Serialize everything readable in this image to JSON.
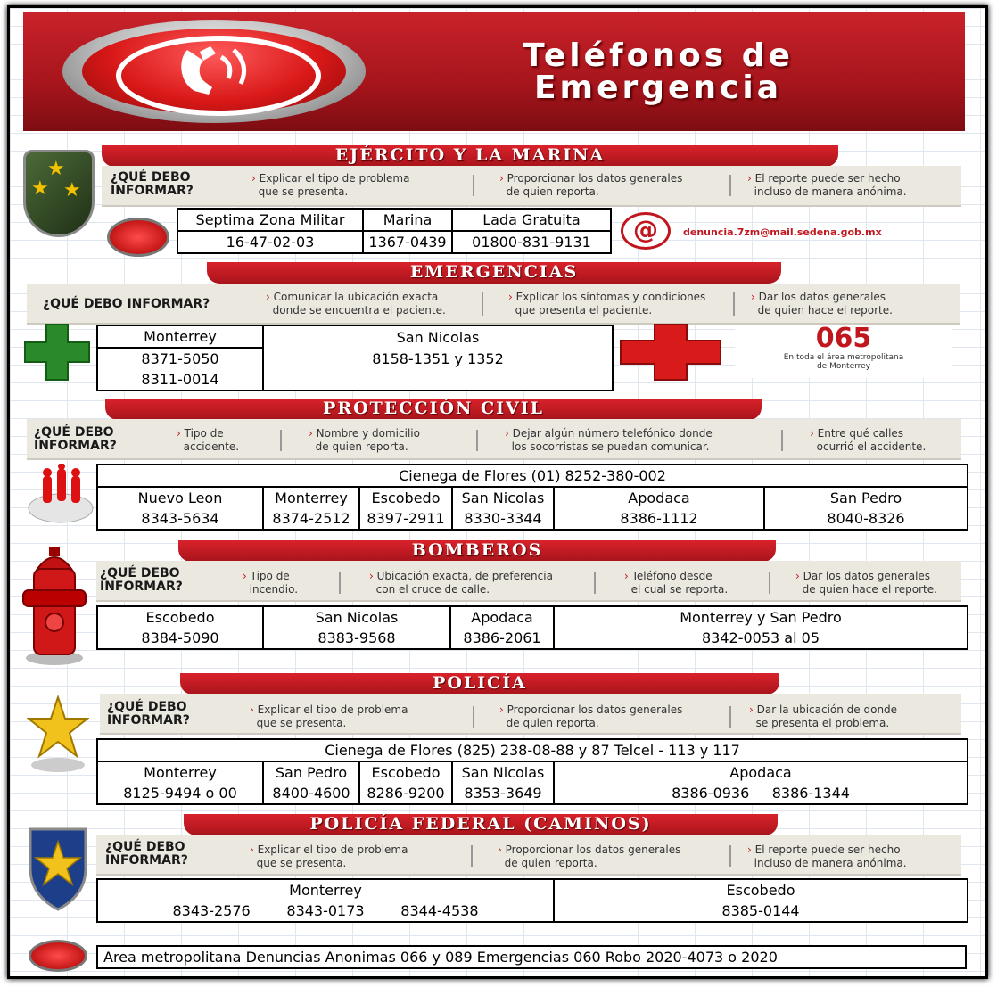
{
  "header": {
    "title_line1": "Teléfonos de",
    "title_line2": "Emergencia"
  },
  "common": {
    "q_two_line_1": "¿QUÉ DEBO",
    "q_two_line_2": "INFORMAR?",
    "q_single": "¿QUÉ DEBO INFORMAR?"
  },
  "ejercito": {
    "ribbon": "EJÉRCITO Y LA MARINA",
    "notes": [
      [
        "Explicar el tipo de problema",
        "que se presenta."
      ],
      [
        "Proporcionar los datos generales",
        "de quien reporta."
      ],
      [
        "El reporte puede ser hecho",
        "incluso de manera anónima."
      ]
    ],
    "cells": [
      [
        "Septima Zona Militar",
        "16-47-02-03"
      ],
      [
        "Marina",
        "1367-0439"
      ],
      [
        "Lada Gratuita",
        "01800-831-9131"
      ]
    ],
    "email": "denuncia.7zm@mail.sedena.gob.mx",
    "at": "@"
  },
  "emergencias": {
    "ribbon": "EMERGENCIAS",
    "notes": [
      [
        "Comunicar la ubicación exacta",
        "donde se encuentra el paciente."
      ],
      [
        "Explicar los síntomas y condiciones",
        "que presenta el paciente."
      ],
      [
        "Dar los datos generales",
        "de quien hace el reporte."
      ]
    ],
    "cells": [
      [
        "Monterrey",
        "8371-5050",
        "8311-0014"
      ],
      [
        "San Nicolas",
        "8158-1351 y 1352"
      ]
    ],
    "badge_number": "065",
    "badge_text_1": "En toda el área metropolitana",
    "badge_text_2": "de Monterrey"
  },
  "proteccion": {
    "ribbon": "PROTECCIÓN CIVIL",
    "notes": [
      [
        "Tipo de",
        "accidente."
      ],
      [
        "Nombre y domicilio",
        "de quien reporta."
      ],
      [
        "Dejar algún número telefónico donde",
        "los socorristas se puedan comunicar."
      ],
      [
        "Entre qué calles",
        "ocurrió el accidente."
      ]
    ],
    "top_row": "Cienega de Flores (01) 8252-380-002",
    "cells": [
      [
        "Nuevo Leon",
        "8343-5634"
      ],
      [
        "Monterrey",
        "8374-2512"
      ],
      [
        "Escobedo",
        "8397-2911"
      ],
      [
        "San Nicolas",
        "8330-3344"
      ],
      [
        "Apodaca",
        "8386-1112"
      ],
      [
        "San Pedro",
        "8040-8326"
      ]
    ]
  },
  "bomberos": {
    "ribbon": "BOMBEROS",
    "notes": [
      [
        "Tipo de",
        "incendio."
      ],
      [
        "Ubicación exacta, de preferencia",
        "con el cruce de calle."
      ],
      [
        "Teléfono desde",
        "el cual se reporta."
      ],
      [
        "Dar los datos generales",
        "de quien hace el reporte."
      ]
    ],
    "cells": [
      [
        "Escobedo",
        "8384-5090"
      ],
      [
        "San Nicolas",
        "8383-9568"
      ],
      [
        "Apodaca",
        "8386-2061"
      ],
      [
        "Monterrey y San Pedro",
        "8342-0053 al 05"
      ]
    ]
  },
  "policia": {
    "ribbon": "POLICÍA",
    "notes": [
      [
        "Explicar el tipo de problema",
        "que se presenta."
      ],
      [
        "Proporcionar los datos generales",
        "de quien reporta."
      ],
      [
        "Dar la ubicación de donde",
        "se presenta el problema."
      ]
    ],
    "top_row": "Cienega de Flores (825) 238-08-88 y 87  Telcel -  113 y 117",
    "cells": [
      [
        "Monterrey",
        "8125-9494 o 00"
      ],
      [
        "San Pedro",
        "8400-4600"
      ],
      [
        "Escobedo",
        "8286-9200"
      ],
      [
        "San Nicolas",
        "8353-3649"
      ],
      [
        "Apodaca",
        "8386-0936     8386-1344"
      ]
    ]
  },
  "federal": {
    "ribbon": "POLICÍA FEDERAL (CAMINOS)",
    "notes": [
      [
        "Explicar el tipo de problema",
        "que se presenta."
      ],
      [
        "Proporcionar los datos generales",
        "de quien reporta."
      ],
      [
        "El reporte puede ser hecho",
        "incluso de manera anónima."
      ]
    ],
    "cells": [
      [
        "Monterrey",
        "8343-2576        8343-0173        8344-4538"
      ],
      [
        "Escobedo",
        "8385-0144"
      ]
    ]
  },
  "footer": {
    "text": "Area metropolitana  Denuncias Anonimas 066 y 089   Emergencias 060      Robo 2020-4073 o 2020"
  },
  "colors": {
    "brand_red": "#c0161e",
    "note_bg": "#ebe8e0"
  }
}
